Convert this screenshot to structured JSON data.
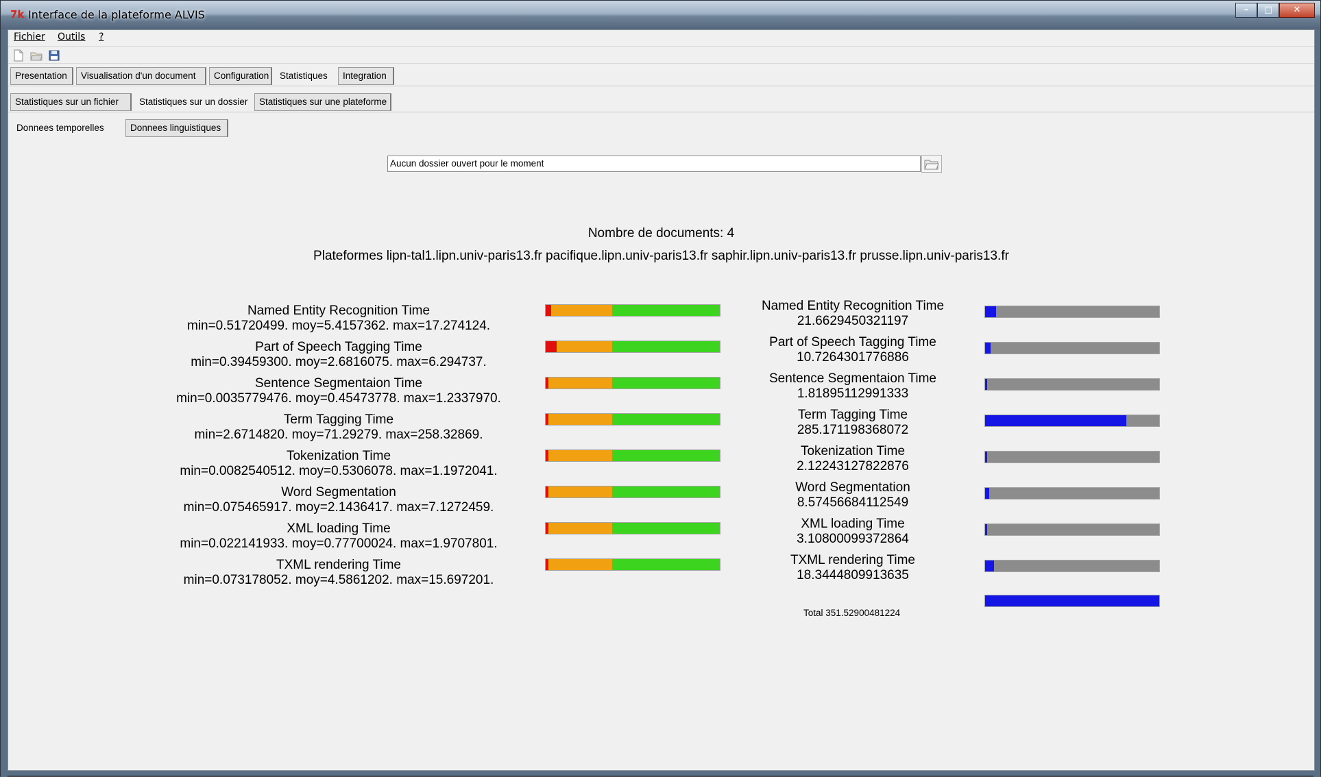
{
  "window": {
    "title": "Interface de la plateforme ALVIS",
    "icon": "tk-app-icon"
  },
  "menu": {
    "items": [
      "Fichier",
      "Outils",
      "?"
    ]
  },
  "toolbar": {
    "icons": [
      "new-file-icon",
      "open-folder-icon",
      "save-icon"
    ]
  },
  "tabs_main": {
    "items": [
      "Presentation",
      "Visualisation d'un document",
      "Configuration",
      "Statistiques",
      "Integration"
    ],
    "active": "Statistiques"
  },
  "tabs_stats": {
    "items": [
      "Statistiques sur un fichier",
      "Statistiques sur un dossier",
      "Statistiques sur une plateforme"
    ],
    "active": "Statistiques sur un dossier"
  },
  "tabs_data": {
    "items": [
      "Donnees temporelles",
      "Donnees linguistiques"
    ],
    "active": "Donnees temporelles"
  },
  "folder_path": {
    "value": "Aucun dossier ouvert pour le moment"
  },
  "summary": {
    "doc_count": "Nombre de documents: 4",
    "platforms": "Plateformes  lipn-tal1.lipn.univ-paris13.fr pacifique.lipn.univ-paris13.fr saphir.lipn.univ-paris13.fr prusse.lipn.univ-paris13.fr"
  },
  "colors": {
    "bar_red": "#e01010",
    "bar_orange": "#f0a010",
    "bar_green": "#3cd41f",
    "bar_blue": "#1515e6",
    "bar_gray": "#8c8c8c"
  },
  "stats_left": [
    {
      "name": "Named Entity Recognition Time",
      "range": "min=0.51720499. moy=5.4157362. max=17.274124.",
      "min": 0.51720499,
      "moy": 5.4157362,
      "max": 17.274124
    },
    {
      "name": "Part of Speech Tagging Time",
      "range": "min=0.39459300. moy=2.6816075. max=6.294737.",
      "min": 0.394593,
      "moy": 2.6816075,
      "max": 6.294737
    },
    {
      "name": "Sentence Segmentaion Time",
      "range": "min=0.0035779476. moy=0.45473778. max=1.2337970.",
      "min": 0.0035779476,
      "moy": 0.45473778,
      "max": 1.233797
    },
    {
      "name": "Term Tagging Time",
      "range": "min=2.6714820. moy=71.29279. max=258.32869.",
      "min": 2.671482,
      "moy": 71.29279,
      "max": 258.32869
    },
    {
      "name": "Tokenization Time",
      "range": "min=0.0082540512. moy=0.5306078. max=1.1972041.",
      "min": 0.0082540512,
      "moy": 0.5306078,
      "max": 1.1972041
    },
    {
      "name": "Word Segmentation",
      "range": "min=0.075465917. moy=2.1436417. max=7.1272459.",
      "min": 0.075465917,
      "moy": 2.1436417,
      "max": 7.1272459
    },
    {
      "name": "XML loading Time",
      "range": "min=0.022141933. moy=0.77700024. max=1.9707801.",
      "min": 0.022141933,
      "moy": 0.77700024,
      "max": 1.9707801
    },
    {
      "name": "TXML rendering Time",
      "range": "min=0.073178052. moy=4.5861202. max=15.697201.",
      "min": 0.073178052,
      "moy": 4.5861202,
      "max": 15.697201
    }
  ],
  "stats_right": [
    {
      "name": "Named Entity Recognition Time",
      "total": "21.6629450321197",
      "value": 21.6629450321197
    },
    {
      "name": "Part of Speech Tagging Time",
      "total": "10.7264301776886",
      "value": 10.7264301776886
    },
    {
      "name": "Sentence Segmentaion Time",
      "total": "1.81895112991333",
      "value": 1.81895112991333
    },
    {
      "name": "Term Tagging Time",
      "total": "285.171198368072",
      "value": 285.171198368072
    },
    {
      "name": "Tokenization Time",
      "total": "2.12243127822876",
      "value": 2.12243127822876
    },
    {
      "name": "Word Segmentation",
      "total": "8.57456684112549",
      "value": 8.57456684112549
    },
    {
      "name": "XML loading Time",
      "total": "3.10800099372864",
      "value": 3.10800099372864
    },
    {
      "name": "TXML rendering Time",
      "total": "18.3444809913635",
      "value": 18.3444809913635
    }
  ],
  "total": {
    "label": "Total 351.52900481224",
    "value": 351.52900481224
  }
}
